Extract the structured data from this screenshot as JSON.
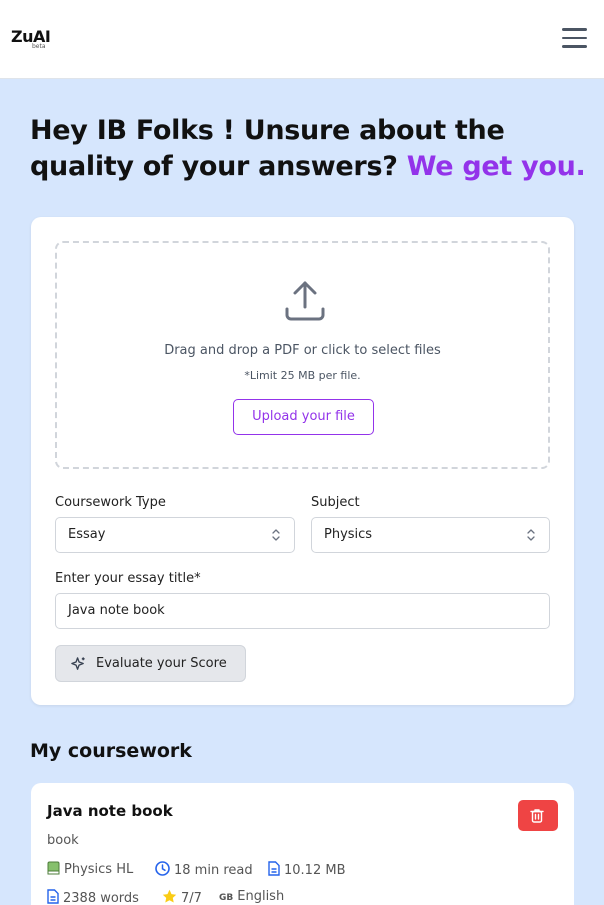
{
  "header": {
    "logo": "ZuAI",
    "logo_badge": "beta"
  },
  "hero": {
    "line_main": "Hey IB Folks ! Unsure about the quality of your answers?",
    "line_accent": "We get you."
  },
  "upload": {
    "instruction": "Drag and drop a PDF or click to select files",
    "limit": "*Limit 25 MB per file.",
    "button_label": "Upload your file"
  },
  "form": {
    "coursework_type_label": "Coursework Type",
    "coursework_type_value": "Essay",
    "subject_label": "Subject",
    "subject_value": "Physics",
    "title_label": "Enter your essay title*",
    "title_value": "Java note book",
    "evaluate_label": "Evaluate your Score"
  },
  "coursework": {
    "section_title": "My coursework",
    "items": [
      {
        "title": "Java note book",
        "subtitle": "book",
        "subject": "Physics HL",
        "read_time": "18 min read",
        "file_size": "10.12 MB",
        "words": "2388 words",
        "score": "7/7",
        "language_code": "GB",
        "language": "English"
      }
    ]
  },
  "colors": {
    "accent": "#9333ea",
    "background": "#d6e6fd",
    "danger": "#ef4444"
  }
}
